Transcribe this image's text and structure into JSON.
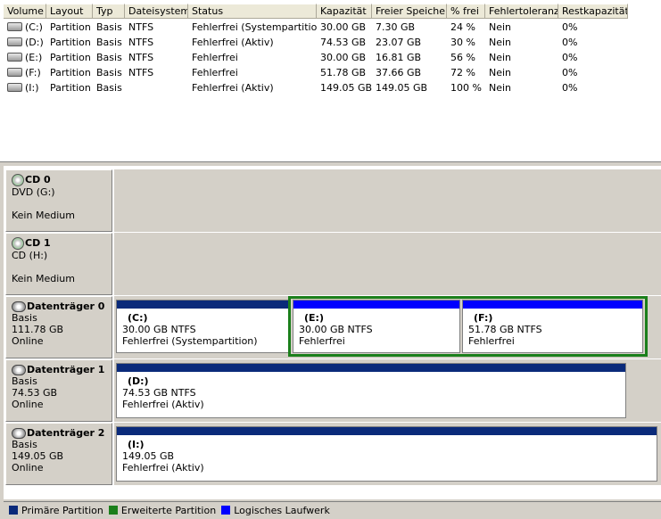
{
  "colors": {
    "primary_partition": "#0a2a7a",
    "extended_partition": "#1b7f1b",
    "logical_drive": "#0000ff"
  },
  "table": {
    "headers": [
      "Volume",
      "Layout",
      "Typ",
      "Dateisystem",
      "Status",
      "Kapazität",
      "Freier Speicher",
      "% frei",
      "Fehlertoleranz",
      "Restkapazität"
    ],
    "rows": [
      [
        "(C:)",
        "Partition",
        "Basis",
        "NTFS",
        "Fehlerfrei (Systempartition)",
        "30.00 GB",
        "7.30 GB",
        "24 %",
        "Nein",
        "0%"
      ],
      [
        "(D:)",
        "Partition",
        "Basis",
        "NTFS",
        "Fehlerfrei (Aktiv)",
        "74.53 GB",
        "23.07 GB",
        "30 %",
        "Nein",
        "0%"
      ],
      [
        "(E:)",
        "Partition",
        "Basis",
        "NTFS",
        "Fehlerfrei",
        "30.00 GB",
        "16.81 GB",
        "56 %",
        "Nein",
        "0%"
      ],
      [
        "(F:)",
        "Partition",
        "Basis",
        "NTFS",
        "Fehlerfrei",
        "51.78 GB",
        "37.66 GB",
        "72 %",
        "Nein",
        "0%"
      ],
      [
        "(I:)",
        "Partition",
        "Basis",
        "",
        "Fehlerfrei (Aktiv)",
        "149.05 GB",
        "149.05 GB",
        "100 %",
        "Nein",
        "0%"
      ]
    ]
  },
  "disks": {
    "cd0": {
      "name": "CD 0",
      "sub": "DVD (G:)",
      "status": "Kein Medium"
    },
    "cd1": {
      "name": "CD 1",
      "sub": "CD (H:)",
      "status": "Kein Medium"
    },
    "d0": {
      "name": "Datenträger 0",
      "type": "Basis",
      "size": "111.78 GB",
      "state": "Online",
      "parts": [
        {
          "letter": "(C:)",
          "size": "30.00 GB NTFS",
          "status": "Fehlerfrei (Systempartition)"
        },
        {
          "letter": "(E:)",
          "size": "30.00 GB NTFS",
          "status": "Fehlerfrei"
        },
        {
          "letter": "(F:)",
          "size": "51.78 GB NTFS",
          "status": "Fehlerfrei"
        }
      ]
    },
    "d1": {
      "name": "Datenträger 1",
      "type": "Basis",
      "size": "74.53 GB",
      "state": "Online",
      "parts": [
        {
          "letter": "(D:)",
          "size": "74.53 GB NTFS",
          "status": "Fehlerfrei (Aktiv)"
        }
      ]
    },
    "d2": {
      "name": "Datenträger 2",
      "type": "Basis",
      "size": "149.05 GB",
      "state": "Online",
      "parts": [
        {
          "letter": "(I:)",
          "size": "149.05 GB",
          "status": "Fehlerfrei (Aktiv)"
        }
      ]
    }
  },
  "legend": {
    "primary": "Primäre Partition",
    "extended": "Erweiterte Partition",
    "logical": "Logisches Laufwerk"
  }
}
